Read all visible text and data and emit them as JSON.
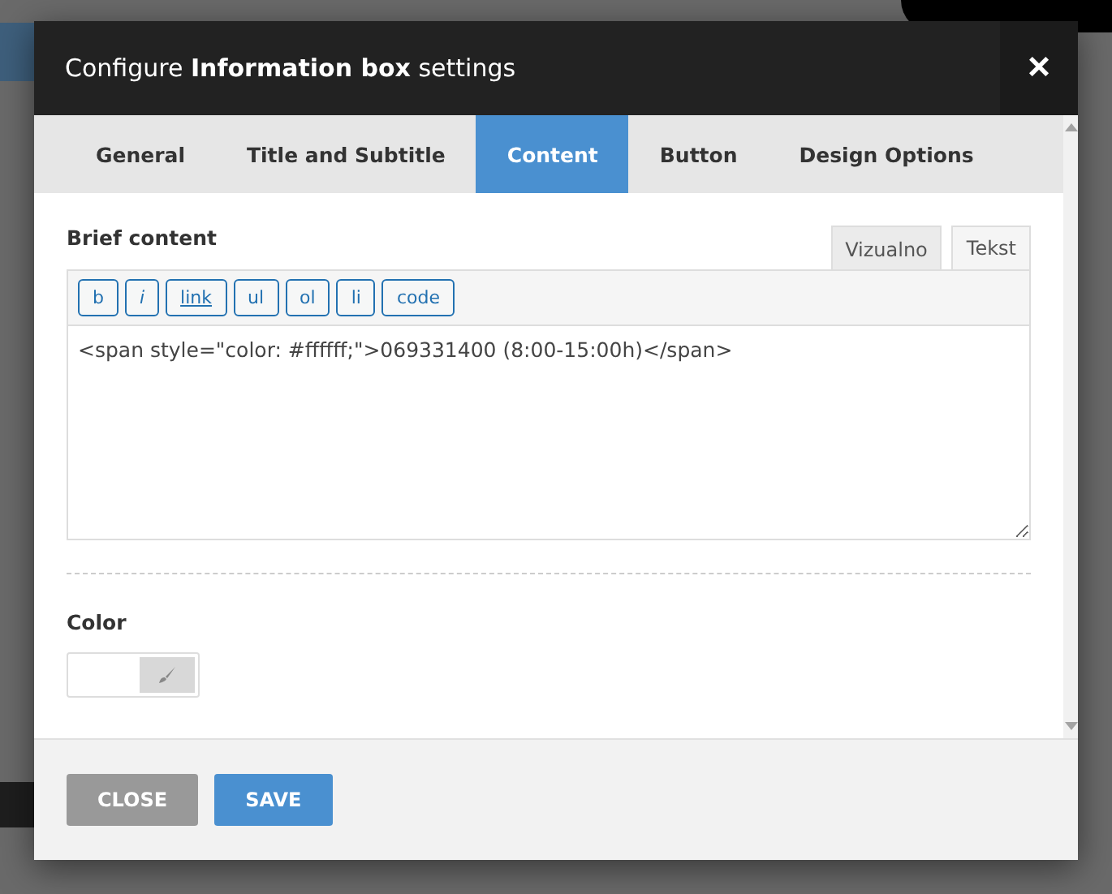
{
  "dialog": {
    "title": "Configure **Information box** settings",
    "close_label": "×",
    "tabs": [
      {
        "label": "General",
        "selected": false
      },
      {
        "label": "Title and Subtitle",
        "selected": false
      },
      {
        "label": "Content",
        "selected": true
      },
      {
        "label": "Button",
        "selected": false
      },
      {
        "label": "Design Options",
        "selected": false
      }
    ],
    "brief_content": {
      "label": "Brief content",
      "editor_tabs": [
        {
          "label": "Vizualno",
          "selected": false
        },
        {
          "label": "Tekst",
          "selected": true
        }
      ],
      "quicktags": [
        {
          "label": "b",
          "kind": "plain"
        },
        {
          "label": "i",
          "kind": "italic"
        },
        {
          "label": "link",
          "kind": "underline"
        },
        {
          "label": "ul",
          "kind": "plain"
        },
        {
          "label": "ol",
          "kind": "plain"
        },
        {
          "label": "li",
          "kind": "plain"
        },
        {
          "label": "code",
          "kind": "plain"
        }
      ],
      "value": "<span style=\"color: #ffffff;\">069331400 (8:00-15:00h)</span>"
    },
    "color": {
      "label": "Color"
    },
    "buttons": [
      {
        "label": "CLOSE",
        "kind": "secondary"
      },
      {
        "label": "SAVE",
        "kind": "primary"
      }
    ]
  }
}
